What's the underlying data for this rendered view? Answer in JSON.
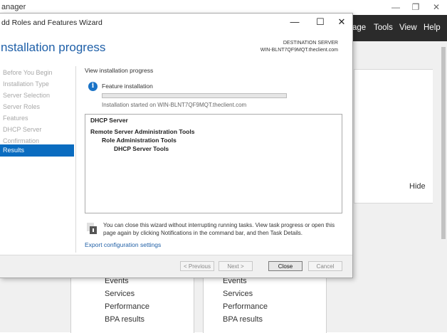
{
  "background_window": {
    "title": "anager",
    "window_controls": [
      "—",
      "❐",
      "✕"
    ],
    "menu": [
      "age",
      "Tools",
      "View",
      "Help"
    ],
    "hide_label": "Hide",
    "tile_left_items": [
      "Events",
      "Services",
      "Performance",
      "BPA results"
    ],
    "tile_right_items": [
      "Events",
      "Services",
      "Performance",
      "BPA results"
    ]
  },
  "wizard": {
    "title": "dd Roles and Features Wizard",
    "window_controls": [
      "—",
      "☐",
      "✕"
    ],
    "heading": "nstallation progress",
    "destination_label": "DESTINATION SERVER",
    "destination_server": "WIN-BLNT7QF9MQT.theclient.com",
    "nav": [
      {
        "label": "Before You Begin",
        "active": false
      },
      {
        "label": "Installation Type",
        "active": false
      },
      {
        "label": "Server Selection",
        "active": false
      },
      {
        "label": "Server Roles",
        "active": false
      },
      {
        "label": "Features",
        "active": false
      },
      {
        "label": "DHCP Server",
        "active": false
      },
      {
        "label": "Confirmation",
        "active": false
      },
      {
        "label": "Results",
        "active": true
      }
    ],
    "view_progress_label": "View installation progress",
    "info_icon_glyph": "i",
    "feature_installation": "Feature installation",
    "progress_fraction": 0.0,
    "install_started": "Installation started on WIN-BLNT7QF9MQT.theclient.com",
    "results": [
      {
        "text": "DHCP Server",
        "level": 0
      },
      {
        "text": "Remote Server Administration Tools",
        "level": 0
      },
      {
        "text": "Role Administration Tools",
        "level": 1
      },
      {
        "text": "DHCP Server Tools",
        "level": 2
      }
    ],
    "notice": "You can close this wizard without interrupting running tasks. View task progress or open this page again by clicking Notifications in the command bar, and then Task Details.",
    "export_link": "Export configuration settings",
    "buttons": {
      "previous": "< Previous",
      "next": "Next >",
      "close": "Close",
      "cancel": "Cancel"
    }
  },
  "colors": {
    "accent": "#1e5fa8",
    "nav_active": "#0a6cc0",
    "menubar": "#2b2b2b",
    "progress": "#06b025"
  }
}
